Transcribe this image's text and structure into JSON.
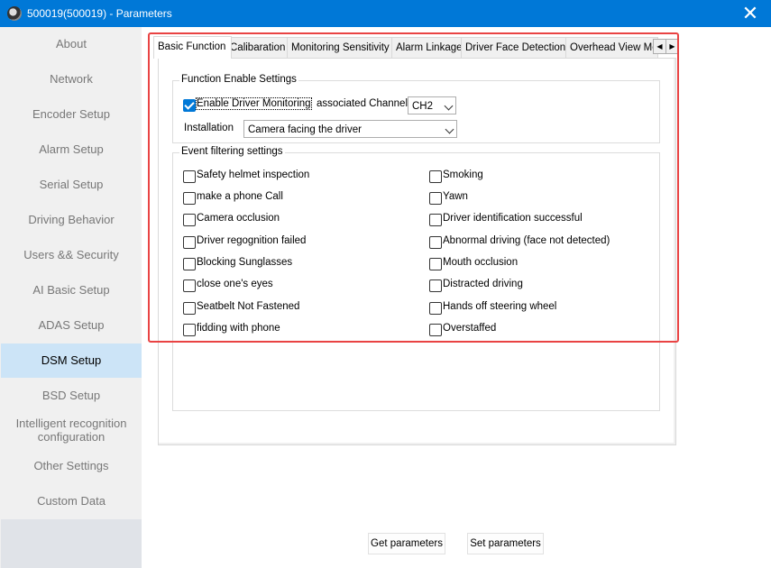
{
  "window": {
    "title": "500019(500019) - Parameters",
    "close_glyph": "✕"
  },
  "sidebar": {
    "items": [
      {
        "label": "About"
      },
      {
        "label": "Network"
      },
      {
        "label": "Encoder Setup"
      },
      {
        "label": "Alarm Setup"
      },
      {
        "label": "Serial Setup"
      },
      {
        "label": "Driving Behavior"
      },
      {
        "label": "Users && Security"
      },
      {
        "label": "AI Basic Setup"
      },
      {
        "label": "ADAS Setup"
      },
      {
        "label": "DSM Setup"
      },
      {
        "label": "BSD Setup"
      },
      {
        "label": "Intelligent recognition configuration"
      },
      {
        "label": "Other Settings"
      },
      {
        "label": "Custom Data"
      }
    ],
    "active": "DSM Setup"
  },
  "tabs": {
    "items": [
      {
        "label": "Basic Function"
      },
      {
        "label": "Calibaration"
      },
      {
        "label": "Monitoring Sensitivity"
      },
      {
        "label": "Alarm Linkage"
      },
      {
        "label": "Driver Face Detection"
      },
      {
        "label": "Overhead View Mc"
      }
    ],
    "active": "Basic Function",
    "scroll_left": "◀",
    "scroll_right": "▶"
  },
  "function_enable": {
    "title": "Function Enable Settings",
    "enable_label": "Enable Driver Monitoring",
    "enable_checked": true,
    "channel_label": "associated Channel:",
    "channel_value": "CH2",
    "installation_label": "Installation",
    "installation_value": "Camera facing the driver"
  },
  "event_filtering": {
    "title": "Event filtering settings",
    "left": [
      {
        "label": "Safety helmet inspection",
        "checked": false
      },
      {
        "label": "make a phone Call",
        "checked": false
      },
      {
        "label": "Camera occlusion",
        "checked": false
      },
      {
        "label": "Driver regognition failed",
        "checked": false
      },
      {
        "label": "Blocking Sunglasses",
        "checked": false
      },
      {
        "label": "close one's eyes",
        "checked": false
      },
      {
        "label": "Seatbelt Not Fastened",
        "checked": false
      },
      {
        "label": "fidding with phone",
        "checked": false
      }
    ],
    "right": [
      {
        "label": "Smoking",
        "checked": false
      },
      {
        "label": "Yawn",
        "checked": false
      },
      {
        "label": "Driver identification successful",
        "checked": false
      },
      {
        "label": "Abnormal driving (face not detected)",
        "checked": false
      },
      {
        "label": "Mouth occlusion",
        "checked": false
      },
      {
        "label": "Distracted driving",
        "checked": false
      },
      {
        "label": "Hands off steering wheel",
        "checked": false
      },
      {
        "label": "Overstaffed",
        "checked": false
      }
    ]
  },
  "buttons": {
    "get": "Get parameters",
    "set": "Set parameters"
  },
  "colors": {
    "titlebar": "#0078d7",
    "sidebar_active": "#cce4f7",
    "highlight": "#e94343"
  }
}
